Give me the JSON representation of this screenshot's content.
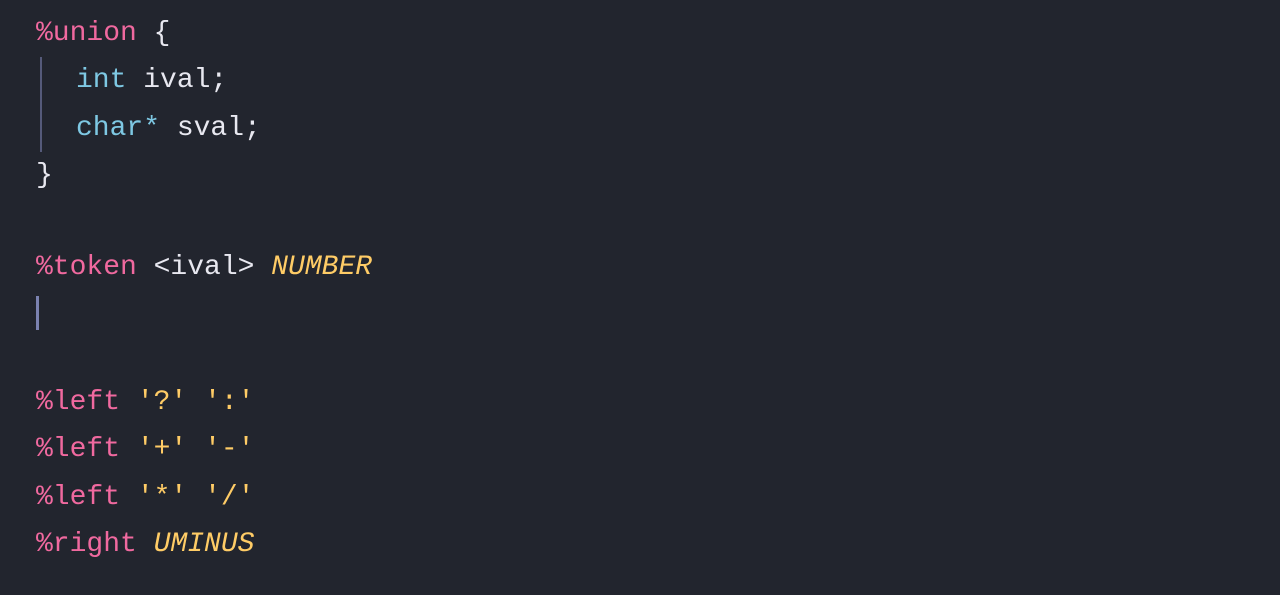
{
  "editor": {
    "background": "#22252e",
    "lines": [
      {
        "id": "union-open",
        "parts": [
          {
            "text": "%union",
            "class": "keyword"
          },
          {
            "text": " {",
            "class": "punctuation"
          }
        ]
      },
      {
        "id": "ival-line",
        "indent": true,
        "parts": [
          {
            "text": "int",
            "class": "type-keyword"
          },
          {
            "text": " ival;",
            "class": "identifier"
          }
        ]
      },
      {
        "id": "sval-line",
        "indent": true,
        "parts": [
          {
            "text": "char*",
            "class": "type-keyword"
          },
          {
            "text": " sval;",
            "class": "identifier"
          }
        ]
      },
      {
        "id": "union-close",
        "parts": [
          {
            "text": "}",
            "class": "punctuation"
          }
        ]
      },
      {
        "id": "empty1",
        "parts": []
      },
      {
        "id": "token-line",
        "parts": [
          {
            "text": "%token",
            "class": "keyword"
          },
          {
            "text": " <ival> ",
            "class": "angle-bracket"
          },
          {
            "text": "NUMBER",
            "class": "token-name"
          }
        ]
      },
      {
        "id": "cursor-line",
        "isCursor": true,
        "parts": []
      },
      {
        "id": "empty2",
        "parts": []
      },
      {
        "id": "left1",
        "parts": [
          {
            "text": "%left",
            "class": "keyword"
          },
          {
            "text": " ",
            "class": "punctuation"
          },
          {
            "text": "'?'",
            "class": "string-literal"
          },
          {
            "text": " ",
            "class": "punctuation"
          },
          {
            "text": "':'",
            "class": "string-literal"
          }
        ]
      },
      {
        "id": "left2",
        "parts": [
          {
            "text": "%left",
            "class": "keyword"
          },
          {
            "text": " ",
            "class": "punctuation"
          },
          {
            "text": "'+'",
            "class": "string-literal"
          },
          {
            "text": " ",
            "class": "punctuation"
          },
          {
            "text": "'-'",
            "class": "string-literal"
          }
        ]
      },
      {
        "id": "left3",
        "parts": [
          {
            "text": "%left",
            "class": "keyword"
          },
          {
            "text": " ",
            "class": "punctuation"
          },
          {
            "text": "'*'",
            "class": "string-literal"
          },
          {
            "text": " ",
            "class": "punctuation"
          },
          {
            "text": "'/'",
            "class": "string-literal"
          }
        ]
      },
      {
        "id": "right1",
        "parts": [
          {
            "text": "%right",
            "class": "keyword"
          },
          {
            "text": " ",
            "class": "punctuation"
          },
          {
            "text": "UMINUS",
            "class": "token-name"
          }
        ]
      }
    ]
  }
}
